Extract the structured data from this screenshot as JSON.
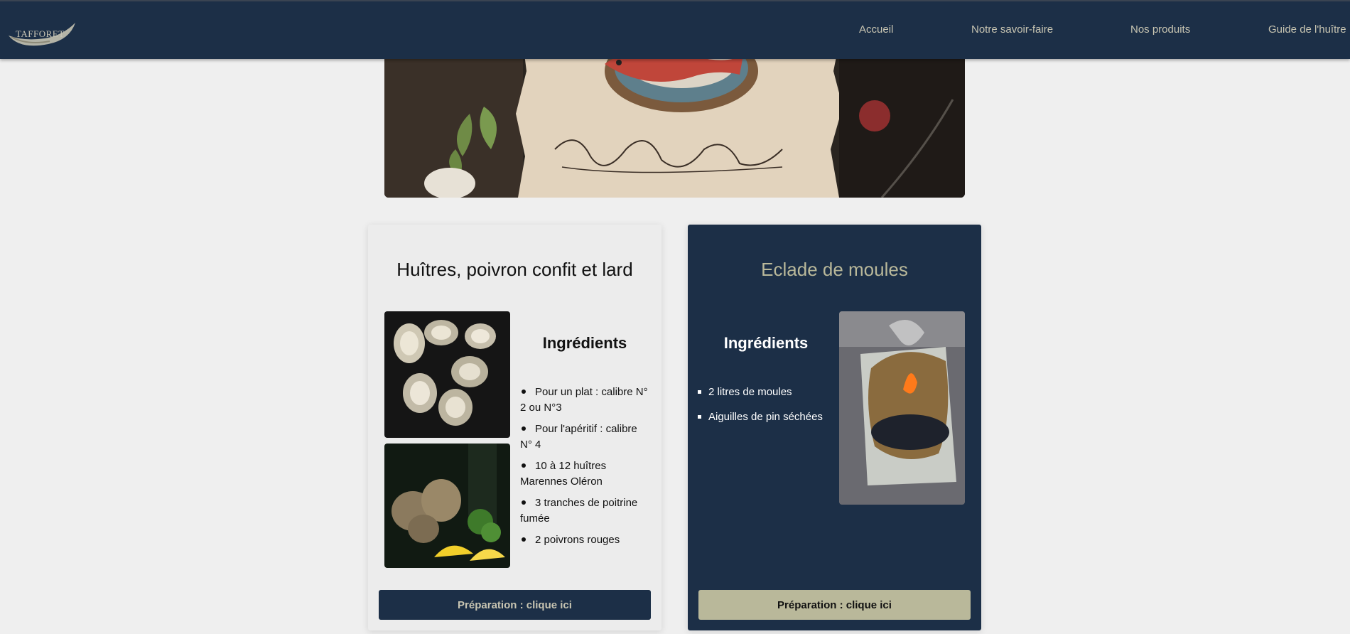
{
  "brand": {
    "logo_text": "TAFFORET"
  },
  "nav": {
    "items": [
      {
        "label": "Accueil"
      },
      {
        "label": "Notre savoir-faire"
      },
      {
        "label": "Nos produits"
      },
      {
        "label": "Guide de l'huître"
      }
    ]
  },
  "hero": {
    "image_alt": ""
  },
  "recipes": [
    {
      "title": "Huîtres, poivron confit et lard",
      "ingredients_title": "Ingrédients",
      "ingredients": [
        "Pour un plat : calibre N° 2 ou N°3",
        "Pour l'apéritif : calibre N° 4",
        "10 à 12 huîtres Marennes Oléron",
        "3 tranches de poitrine fumée",
        "2 poivrons rouges"
      ],
      "button_label": "Préparation : clique ici"
    },
    {
      "title": "Eclade de moules",
      "ingredients_title": "Ingrédients",
      "ingredients": [
        "2 litres de moules",
        "Aiguilles de pin séchées"
      ],
      "button_label": "Préparation : clique ici"
    }
  ],
  "colors": {
    "navy": "#1c2f47",
    "khaki": "#b9b89a",
    "page_bg": "#efefef"
  }
}
